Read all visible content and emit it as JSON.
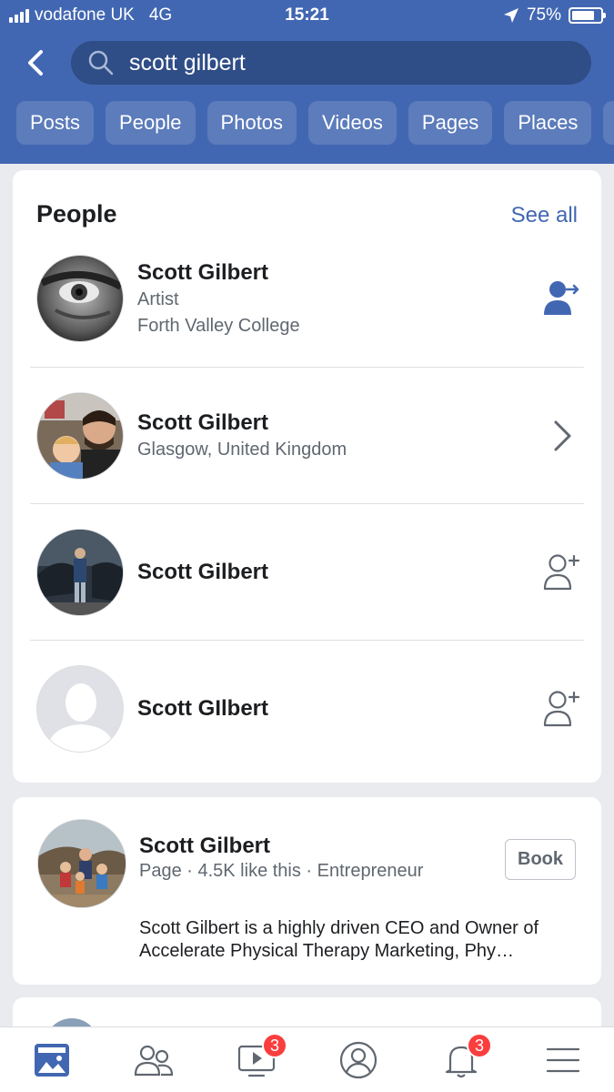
{
  "status_bar": {
    "carrier": "vodafone UK",
    "network": "4G",
    "time": "15:21",
    "battery": "75%"
  },
  "search": {
    "query": "scott gilbert"
  },
  "filters": [
    "Posts",
    "People",
    "Photos",
    "Videos",
    "Pages",
    "Places"
  ],
  "people_section": {
    "title": "People",
    "see_all": "See all",
    "results": [
      {
        "name": "Scott Gilbert",
        "line1": "Artist",
        "line2": "Forth Valley College",
        "action": "message-profile-icon"
      },
      {
        "name": "Scott Gilbert",
        "line1": "Glasgow, United Kingdom",
        "action": "chevron-right-icon"
      },
      {
        "name": "Scott Gilbert",
        "action": "add-friend-icon"
      },
      {
        "name": "Scott GIlbert",
        "action": "add-friend-icon"
      }
    ]
  },
  "page_result": {
    "name": "Scott Gilbert",
    "meta": "Page · 4.5K like this · Entrepreneur",
    "button": "Book",
    "description": "Scott Gilbert is a highly driven CEO and Owner of Accelerate Physical Therapy Marketing, Phy…"
  },
  "tabbar": {
    "video_badge": "3",
    "notifications_badge": "3"
  },
  "colors": {
    "brand_blue": "#4267b2",
    "search_bg": "#2f4d86",
    "chip_bg": "#5c7cbb",
    "badge_red": "#fa3e3e"
  }
}
